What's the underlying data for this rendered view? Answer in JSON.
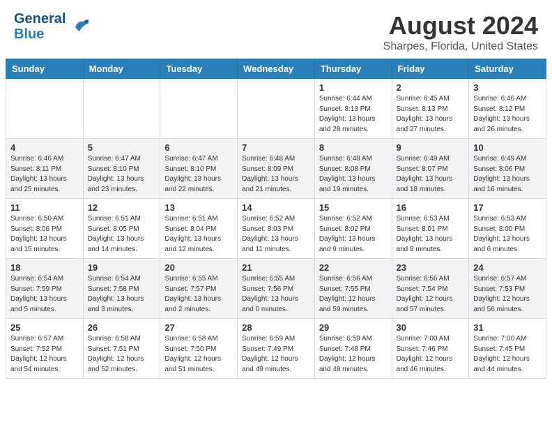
{
  "header": {
    "logo_line1": "General",
    "logo_line2": "Blue",
    "month_year": "August 2024",
    "location": "Sharpes, Florida, United States"
  },
  "days_of_week": [
    "Sunday",
    "Monday",
    "Tuesday",
    "Wednesday",
    "Thursday",
    "Friday",
    "Saturday"
  ],
  "weeks": [
    [
      {
        "day": "",
        "info": ""
      },
      {
        "day": "",
        "info": ""
      },
      {
        "day": "",
        "info": ""
      },
      {
        "day": "",
        "info": ""
      },
      {
        "day": "1",
        "info": "Sunrise: 6:44 AM\nSunset: 8:13 PM\nDaylight: 13 hours\nand 28 minutes."
      },
      {
        "day": "2",
        "info": "Sunrise: 6:45 AM\nSunset: 8:13 PM\nDaylight: 13 hours\nand 27 minutes."
      },
      {
        "day": "3",
        "info": "Sunrise: 6:46 AM\nSunset: 8:12 PM\nDaylight: 13 hours\nand 26 minutes."
      }
    ],
    [
      {
        "day": "4",
        "info": "Sunrise: 6:46 AM\nSunset: 8:11 PM\nDaylight: 13 hours\nand 25 minutes."
      },
      {
        "day": "5",
        "info": "Sunrise: 6:47 AM\nSunset: 8:10 PM\nDaylight: 13 hours\nand 23 minutes."
      },
      {
        "day": "6",
        "info": "Sunrise: 6:47 AM\nSunset: 8:10 PM\nDaylight: 13 hours\nand 22 minutes."
      },
      {
        "day": "7",
        "info": "Sunrise: 6:48 AM\nSunset: 8:09 PM\nDaylight: 13 hours\nand 21 minutes."
      },
      {
        "day": "8",
        "info": "Sunrise: 6:48 AM\nSunset: 8:08 PM\nDaylight: 13 hours\nand 19 minutes."
      },
      {
        "day": "9",
        "info": "Sunrise: 6:49 AM\nSunset: 8:07 PM\nDaylight: 13 hours\nand 18 minutes."
      },
      {
        "day": "10",
        "info": "Sunrise: 6:49 AM\nSunset: 8:06 PM\nDaylight: 13 hours\nand 16 minutes."
      }
    ],
    [
      {
        "day": "11",
        "info": "Sunrise: 6:50 AM\nSunset: 8:06 PM\nDaylight: 13 hours\nand 15 minutes."
      },
      {
        "day": "12",
        "info": "Sunrise: 6:51 AM\nSunset: 8:05 PM\nDaylight: 13 hours\nand 14 minutes."
      },
      {
        "day": "13",
        "info": "Sunrise: 6:51 AM\nSunset: 8:04 PM\nDaylight: 13 hours\nand 12 minutes."
      },
      {
        "day": "14",
        "info": "Sunrise: 6:52 AM\nSunset: 8:03 PM\nDaylight: 13 hours\nand 11 minutes."
      },
      {
        "day": "15",
        "info": "Sunrise: 6:52 AM\nSunset: 8:02 PM\nDaylight: 13 hours\nand 9 minutes."
      },
      {
        "day": "16",
        "info": "Sunrise: 6:53 AM\nSunset: 8:01 PM\nDaylight: 13 hours\nand 8 minutes."
      },
      {
        "day": "17",
        "info": "Sunrise: 6:53 AM\nSunset: 8:00 PM\nDaylight: 13 hours\nand 6 minutes."
      }
    ],
    [
      {
        "day": "18",
        "info": "Sunrise: 6:54 AM\nSunset: 7:59 PM\nDaylight: 13 hours\nand 5 minutes."
      },
      {
        "day": "19",
        "info": "Sunrise: 6:54 AM\nSunset: 7:58 PM\nDaylight: 13 hours\nand 3 minutes."
      },
      {
        "day": "20",
        "info": "Sunrise: 6:55 AM\nSunset: 7:57 PM\nDaylight: 13 hours\nand 2 minutes."
      },
      {
        "day": "21",
        "info": "Sunrise: 6:55 AM\nSunset: 7:56 PM\nDaylight: 13 hours\nand 0 minutes."
      },
      {
        "day": "22",
        "info": "Sunrise: 6:56 AM\nSunset: 7:55 PM\nDaylight: 12 hours\nand 59 minutes."
      },
      {
        "day": "23",
        "info": "Sunrise: 6:56 AM\nSunset: 7:54 PM\nDaylight: 12 hours\nand 57 minutes."
      },
      {
        "day": "24",
        "info": "Sunrise: 6:57 AM\nSunset: 7:53 PM\nDaylight: 12 hours\nand 56 minutes."
      }
    ],
    [
      {
        "day": "25",
        "info": "Sunrise: 6:57 AM\nSunset: 7:52 PM\nDaylight: 12 hours\nand 54 minutes."
      },
      {
        "day": "26",
        "info": "Sunrise: 6:58 AM\nSunset: 7:51 PM\nDaylight: 12 hours\nand 52 minutes."
      },
      {
        "day": "27",
        "info": "Sunrise: 6:58 AM\nSunset: 7:50 PM\nDaylight: 12 hours\nand 51 minutes."
      },
      {
        "day": "28",
        "info": "Sunrise: 6:59 AM\nSunset: 7:49 PM\nDaylight: 12 hours\nand 49 minutes."
      },
      {
        "day": "29",
        "info": "Sunrise: 6:59 AM\nSunset: 7:48 PM\nDaylight: 12 hours\nand 48 minutes."
      },
      {
        "day": "30",
        "info": "Sunrise: 7:00 AM\nSunset: 7:46 PM\nDaylight: 12 hours\nand 46 minutes."
      },
      {
        "day": "31",
        "info": "Sunrise: 7:00 AM\nSunset: 7:45 PM\nDaylight: 12 hours\nand 44 minutes."
      }
    ]
  ]
}
